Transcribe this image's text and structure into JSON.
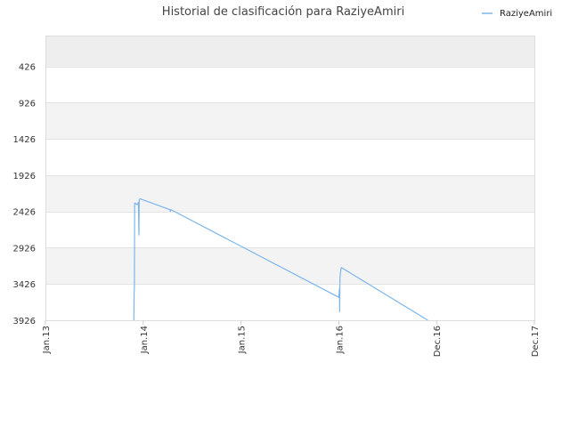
{
  "chart_data": {
    "type": "line",
    "title": "Historial de clasificación para RaziyeAmiri",
    "xlabel": "",
    "ylabel": "",
    "y_inverted": true,
    "y_ticks": [
      426,
      926,
      1426,
      1926,
      2426,
      2926,
      3426,
      3926
    ],
    "ylim": [
      3926,
      0
    ],
    "x_ticks": [
      "Jan.13",
      "Jan.14",
      "Jan.15",
      "Jan.16",
      "Dec.16",
      "Dec.17"
    ],
    "x_tick_dates": [
      "2013-01-01",
      "2014-01-01",
      "2015-01-01",
      "2016-01-01",
      "2016-12-01",
      "2017-12-01"
    ],
    "grid": true,
    "alternating_bands": true,
    "legend_position": "top-right",
    "series": [
      {
        "name": "RaziyeAmiri",
        "color": "#7cb5ec",
        "points": [
          {
            "x": "2013-11-27",
            "y": 3926
          },
          {
            "x": "2013-11-28",
            "y": 3530
          },
          {
            "x": "2013-11-29",
            "y": 3520
          },
          {
            "x": "2013-11-30",
            "y": 2310
          },
          {
            "x": "2013-12-10",
            "y": 2330
          },
          {
            "x": "2013-12-14",
            "y": 2300
          },
          {
            "x": "2013-12-16",
            "y": 2750
          },
          {
            "x": "2013-12-17",
            "y": 2262
          },
          {
            "x": "2013-12-20",
            "y": 2250
          },
          {
            "x": "2014-04-10",
            "y": 2400
          },
          {
            "x": "2014-04-12",
            "y": 2425
          },
          {
            "x": "2014-04-14",
            "y": 2400
          },
          {
            "x": "2016-01-01",
            "y": 3610
          },
          {
            "x": "2016-01-03",
            "y": 3495
          },
          {
            "x": "2016-01-04",
            "y": 3810
          },
          {
            "x": "2016-01-05",
            "y": 3340
          },
          {
            "x": "2016-01-08",
            "y": 3230
          },
          {
            "x": "2016-01-10",
            "y": 3200
          },
          {
            "x": "2016-11-01",
            "y": 3926
          }
        ]
      }
    ]
  }
}
